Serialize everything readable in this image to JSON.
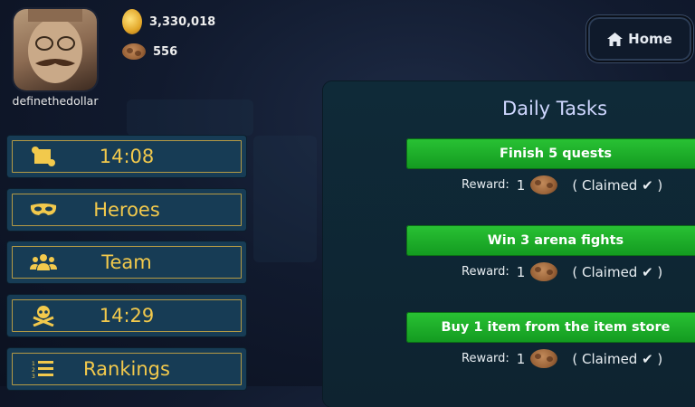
{
  "profile": {
    "username": "definethedollar"
  },
  "currency": {
    "gold": "3,330,018",
    "cookies": "556"
  },
  "nav": {
    "home_label": "Home"
  },
  "menu": [
    {
      "label": "14:08",
      "icon": "scroll-icon"
    },
    {
      "label": "Heroes",
      "icon": "mask-icon"
    },
    {
      "label": "Team",
      "icon": "team-icon"
    },
    {
      "label": "14:29",
      "icon": "skull-crossbones-icon"
    },
    {
      "label": "Rankings",
      "icon": "ranked-list-icon"
    }
  ],
  "daily_tasks": {
    "title": "Daily Tasks",
    "tasks": [
      {
        "name": "Finish 5 quests",
        "reward_label": "Reward:",
        "reward_amount": "1",
        "status": "( Claimed ✔ )"
      },
      {
        "name": "Win 3 arena fights",
        "reward_label": "Reward:",
        "reward_amount": "1",
        "status": "( Claimed ✔ )"
      },
      {
        "name": "Buy 1 item from the item store",
        "reward_label": "Reward:",
        "reward_amount": "1",
        "status": "( Claimed ✔ )"
      }
    ]
  },
  "colors": {
    "menu_text": "#f2c94c",
    "menu_border": "#b59a45",
    "menu_bg": "#173c55",
    "task_bar": "#1faa2a",
    "title": "#cfd7ff"
  }
}
